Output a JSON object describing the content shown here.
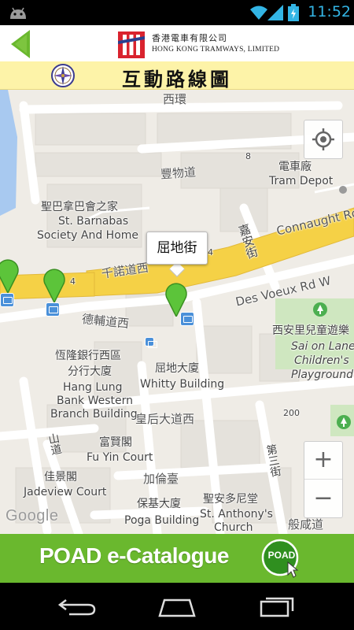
{
  "status_bar": {
    "time": "11:52",
    "icons": [
      "android-icon",
      "wifi-icon",
      "signal-icon",
      "battery-charging-icon"
    ]
  },
  "header": {
    "brand_cn": "香港電車有限公司",
    "brand_en": "HONG KONG TRAMWAYS, LIMITED",
    "back_icon": "back-arrow-icon",
    "accent": "#6ab82e"
  },
  "title_bar": {
    "title": "互動路線圖",
    "background": "#fdf3a8",
    "icon": "compass-icon"
  },
  "map": {
    "callout": "屈地街",
    "labels": {
      "xihuan": "西環",
      "fengwu": "豐物道",
      "tram_depot_cn": "電車廠",
      "tram_depot_en": "Tram Depot",
      "barnabas_cn": "聖巴拿巴會之家",
      "barnabas_en1": "St. Barnabas",
      "barnabas_en2": "Society And Home",
      "connaught": "Connaught Rd",
      "jiaan": "嘉安街",
      "chinuo": "千諾道西",
      "desvoeux": "Des Voeux Rd W",
      "dude": "德輔道西",
      "hanglung_cn1": "恆隆銀行西區",
      "hanglung_cn2": "分行大廈",
      "hanglung_en1": "Hang Lung",
      "hanglung_en2": "Bank Western",
      "hanglung_en3": "Branch Building",
      "whitty_cn": "屈地大廈",
      "whitty_en": "Whitty Building",
      "saisonlane_cn": "西安里兒童遊樂",
      "saisonlane_en1": "Sai on Lane",
      "saisonlane_en2": "Children's",
      "saisonlane_en3": "Playground",
      "queens": "皇后大道西",
      "shanlin": "山道",
      "fuyin_cn": "富賢閣",
      "fuyin_en": "Fu Yin Court",
      "jiadaoge": "佳景閣",
      "jadeview_en": "Jadeview Court",
      "jialun": "加倫臺",
      "poga_cn": "保基大廈",
      "poga_en": "Poga Building",
      "stanthony_cn": "聖安多尼堂",
      "stanthony_en1": "St. Anthony's",
      "stanthony_en2": "Church",
      "disan": "第三街",
      "hamdao": "般咸道",
      "num_8": "8",
      "num_4a": "4",
      "num_4b": "4",
      "num_200": "200"
    },
    "google_label": "Google",
    "zoom_in_label": "+",
    "zoom_out_label": "−"
  },
  "banner": {
    "text": "POAD e-Catalogue",
    "badge_label": "POAD",
    "background": "#6ab82e"
  },
  "nav_bar": {
    "buttons": [
      "back-icon",
      "home-icon",
      "recent-apps-icon"
    ]
  }
}
